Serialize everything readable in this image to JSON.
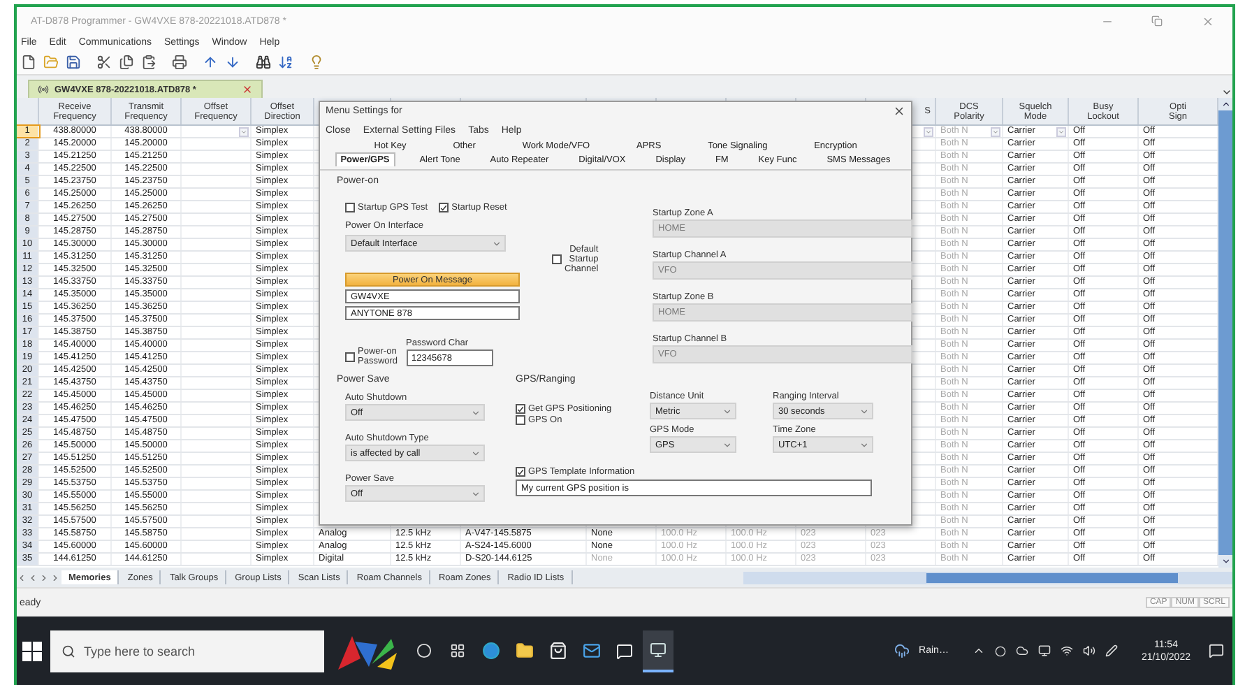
{
  "window": {
    "title": "AT-D878 Programmer - GW4VXE 878-20221018.ATD878 *"
  },
  "menu_bar": [
    "File",
    "Edit",
    "Communications",
    "Settings",
    "Window",
    "Help"
  ],
  "document_tab": {
    "label": "GW4VXE 878-20221018.ATD878 *"
  },
  "grid": {
    "headers": {
      "receive_frequency": "Receive\nFrequency",
      "transmit_frequency": "Transmit\nFrequency",
      "offset_frequency": "Offset\nFrequency",
      "offset_direction": "Offset\nDirection",
      "column_13": "S",
      "dcs_polarity": "DCS\nPolarity",
      "squelch_mode": "Squelch\nMode",
      "busy_lockout": "Busy\nLockout",
      "column_17": "Opti\nSign"
    },
    "rows": [
      {
        "no": "1",
        "selected": true,
        "receive_frequency": "438.80000",
        "transmit_frequency": "438.80000",
        "offset_direction": "Simplex",
        "dcs_polarity": "Both N",
        "squelch_mode": "Carrier",
        "busy_lockout": "Off",
        "column_17": "Off"
      },
      {
        "no": "2",
        "selected": false,
        "receive_frequency": "145.20000",
        "transmit_frequency": "145.20000",
        "offset_direction": "Simplex",
        "dcs_polarity": "Both N",
        "squelch_mode": "Carrier",
        "busy_lockout": "Off",
        "column_17": "Off"
      },
      {
        "no": "3",
        "selected": false,
        "receive_frequency": "145.21250",
        "transmit_frequency": "145.21250",
        "offset_direction": "Simplex",
        "dcs_polarity": "Both N",
        "squelch_mode": "Carrier",
        "busy_lockout": "Off",
        "column_17": "Off"
      },
      {
        "no": "4",
        "selected": false,
        "receive_frequency": "145.22500",
        "transmit_frequency": "145.22500",
        "offset_direction": "Simplex",
        "dcs_polarity": "Both N",
        "squelch_mode": "Carrier",
        "busy_lockout": "Off",
        "column_17": "Off"
      },
      {
        "no": "5",
        "selected": false,
        "receive_frequency": "145.23750",
        "transmit_frequency": "145.23750",
        "offset_direction": "Simplex",
        "dcs_polarity": "Both N",
        "squelch_mode": "Carrier",
        "busy_lockout": "Off",
        "column_17": "Off"
      },
      {
        "no": "6",
        "selected": false,
        "receive_frequency": "145.25000",
        "transmit_frequency": "145.25000",
        "offset_direction": "Simplex",
        "dcs_polarity": "Both N",
        "squelch_mode": "Carrier",
        "busy_lockout": "Off",
        "column_17": "Off"
      },
      {
        "no": "7",
        "selected": false,
        "receive_frequency": "145.26250",
        "transmit_frequency": "145.26250",
        "offset_direction": "Simplex",
        "dcs_polarity": "Both N",
        "squelch_mode": "Carrier",
        "busy_lockout": "Off",
        "column_17": "Off"
      },
      {
        "no": "8",
        "selected": false,
        "receive_frequency": "145.27500",
        "transmit_frequency": "145.27500",
        "offset_direction": "Simplex",
        "dcs_polarity": "Both N",
        "squelch_mode": "Carrier",
        "busy_lockout": "Off",
        "column_17": "Off"
      },
      {
        "no": "9",
        "selected": false,
        "receive_frequency": "145.28750",
        "transmit_frequency": "145.28750",
        "offset_direction": "Simplex",
        "dcs_polarity": "Both N",
        "squelch_mode": "Carrier",
        "busy_lockout": "Off",
        "column_17": "Off"
      },
      {
        "no": "10",
        "selected": false,
        "receive_frequency": "145.30000",
        "transmit_frequency": "145.30000",
        "offset_direction": "Simplex",
        "dcs_polarity": "Both N",
        "squelch_mode": "Carrier",
        "busy_lockout": "Off",
        "column_17": "Off"
      },
      {
        "no": "11",
        "selected": false,
        "receive_frequency": "145.31250",
        "transmit_frequency": "145.31250",
        "offset_direction": "Simplex",
        "dcs_polarity": "Both N",
        "squelch_mode": "Carrier",
        "busy_lockout": "Off",
        "column_17": "Off"
      },
      {
        "no": "12",
        "selected": false,
        "receive_frequency": "145.32500",
        "transmit_frequency": "145.32500",
        "offset_direction": "Simplex",
        "dcs_polarity": "Both N",
        "squelch_mode": "Carrier",
        "busy_lockout": "Off",
        "column_17": "Off"
      },
      {
        "no": "13",
        "selected": false,
        "receive_frequency": "145.33750",
        "transmit_frequency": "145.33750",
        "offset_direction": "Simplex",
        "dcs_polarity": "Both N",
        "squelch_mode": "Carrier",
        "busy_lockout": "Off",
        "column_17": "Off"
      },
      {
        "no": "14",
        "selected": false,
        "receive_frequency": "145.35000",
        "transmit_frequency": "145.35000",
        "offset_direction": "Simplex",
        "dcs_polarity": "Both N",
        "squelch_mode": "Carrier",
        "busy_lockout": "Off",
        "column_17": "Off"
      },
      {
        "no": "15",
        "selected": false,
        "receive_frequency": "145.36250",
        "transmit_frequency": "145.36250",
        "offset_direction": "Simplex",
        "dcs_polarity": "Both N",
        "squelch_mode": "Carrier",
        "busy_lockout": "Off",
        "column_17": "Off"
      },
      {
        "no": "16",
        "selected": false,
        "receive_frequency": "145.37500",
        "transmit_frequency": "145.37500",
        "offset_direction": "Simplex",
        "dcs_polarity": "Both N",
        "squelch_mode": "Carrier",
        "busy_lockout": "Off",
        "column_17": "Off"
      },
      {
        "no": "17",
        "selected": false,
        "receive_frequency": "145.38750",
        "transmit_frequency": "145.38750",
        "offset_direction": "Simplex",
        "dcs_polarity": "Both N",
        "squelch_mode": "Carrier",
        "busy_lockout": "Off",
        "column_17": "Off"
      },
      {
        "no": "18",
        "selected": false,
        "receive_frequency": "145.40000",
        "transmit_frequency": "145.40000",
        "offset_direction": "Simplex",
        "dcs_polarity": "Both N",
        "squelch_mode": "Carrier",
        "busy_lockout": "Off",
        "column_17": "Off"
      },
      {
        "no": "19",
        "selected": false,
        "receive_frequency": "145.41250",
        "transmit_frequency": "145.41250",
        "offset_direction": "Simplex",
        "dcs_polarity": "Both N",
        "squelch_mode": "Carrier",
        "busy_lockout": "Off",
        "column_17": "Off"
      },
      {
        "no": "20",
        "selected": false,
        "receive_frequency": "145.42500",
        "transmit_frequency": "145.42500",
        "offset_direction": "Simplex",
        "dcs_polarity": "Both N",
        "squelch_mode": "Carrier",
        "busy_lockout": "Off",
        "column_17": "Off"
      },
      {
        "no": "21",
        "selected": false,
        "receive_frequency": "145.43750",
        "transmit_frequency": "145.43750",
        "offset_direction": "Simplex",
        "dcs_polarity": "Both N",
        "squelch_mode": "Carrier",
        "busy_lockout": "Off",
        "column_17": "Off"
      },
      {
        "no": "22",
        "selected": false,
        "receive_frequency": "145.45000",
        "transmit_frequency": "145.45000",
        "offset_direction": "Simplex",
        "dcs_polarity": "Both N",
        "squelch_mode": "Carrier",
        "busy_lockout": "Off",
        "column_17": "Off"
      },
      {
        "no": "23",
        "selected": false,
        "receive_frequency": "145.46250",
        "transmit_frequency": "145.46250",
        "offset_direction": "Simplex",
        "dcs_polarity": "Both N",
        "squelch_mode": "Carrier",
        "busy_lockout": "Off",
        "column_17": "Off"
      },
      {
        "no": "24",
        "selected": false,
        "receive_frequency": "145.47500",
        "transmit_frequency": "145.47500",
        "offset_direction": "Simplex",
        "dcs_polarity": "Both N",
        "squelch_mode": "Carrier",
        "busy_lockout": "Off",
        "column_17": "Off"
      },
      {
        "no": "25",
        "selected": false,
        "receive_frequency": "145.48750",
        "transmit_frequency": "145.48750",
        "offset_direction": "Simplex",
        "dcs_polarity": "Both N",
        "squelch_mode": "Carrier",
        "busy_lockout": "Off",
        "column_17": "Off"
      },
      {
        "no": "26",
        "selected": false,
        "receive_frequency": "145.50000",
        "transmit_frequency": "145.50000",
        "offset_direction": "Simplex",
        "dcs_polarity": "Both N",
        "squelch_mode": "Carrier",
        "busy_lockout": "Off",
        "column_17": "Off"
      },
      {
        "no": "27",
        "selected": false,
        "receive_frequency": "145.51250",
        "transmit_frequency": "145.51250",
        "offset_direction": "Simplex",
        "dcs_polarity": "Both N",
        "squelch_mode": "Carrier",
        "busy_lockout": "Off",
        "column_17": "Off"
      },
      {
        "no": "28",
        "selected": false,
        "receive_frequency": "145.52500",
        "transmit_frequency": "145.52500",
        "offset_direction": "Simplex",
        "dcs_polarity": "Both N",
        "squelch_mode": "Carrier",
        "busy_lockout": "Off",
        "column_17": "Off"
      },
      {
        "no": "29",
        "selected": false,
        "receive_frequency": "145.53750",
        "transmit_frequency": "145.53750",
        "offset_direction": "Simplex",
        "dcs_polarity": "Both N",
        "squelch_mode": "Carrier",
        "busy_lockout": "Off",
        "column_17": "Off"
      },
      {
        "no": "30",
        "selected": false,
        "receive_frequency": "145.55000",
        "transmit_frequency": "145.55000",
        "offset_direction": "Simplex",
        "dcs_polarity": "Both N",
        "squelch_mode": "Carrier",
        "busy_lockout": "Off",
        "column_17": "Off"
      },
      {
        "no": "31",
        "selected": false,
        "receive_frequency": "145.56250",
        "transmit_frequency": "145.56250",
        "offset_direction": "Simplex",
        "dcs_polarity": "Both N",
        "squelch_mode": "Carrier",
        "busy_lockout": "Off",
        "column_17": "Off"
      },
      {
        "no": "32",
        "selected": false,
        "receive_frequency": "145.57500",
        "transmit_frequency": "145.57500",
        "offset_direction": "Simplex",
        "dcs_polarity": "Both N",
        "squelch_mode": "Carrier",
        "busy_lockout": "Off",
        "column_17": "Off"
      },
      {
        "no": "33",
        "selected": false,
        "receive_frequency": "145.58750",
        "transmit_frequency": "145.58750",
        "offset_direction": "Simplex",
        "column_6": "Analog",
        "column_7": "12.5 kHz",
        "column_8": "A-V47-145.5875",
        "column_9": {
          "text": "None",
          "disabled": false
        },
        "column_10": "100.0 Hz",
        "column_11": "100.0 Hz",
        "column_12": "023",
        "column_13": "023",
        "dcs_polarity": "Both N",
        "squelch_mode": "Carrier",
        "busy_lockout": "Off",
        "column_17": "Off"
      },
      {
        "no": "34",
        "selected": false,
        "receive_frequency": "145.60000",
        "transmit_frequency": "145.60000",
        "offset_direction": "Simplex",
        "column_6": "Analog",
        "column_7": "12.5 kHz",
        "column_8": "A-S24-145.6000",
        "column_9": {
          "text": "None",
          "disabled": false
        },
        "column_10": "100.0 Hz",
        "column_11": "100.0 Hz",
        "column_12": "023",
        "column_13": "023",
        "dcs_polarity": "Both N",
        "squelch_mode": "Carrier",
        "busy_lockout": "Off",
        "column_17": "Off"
      },
      {
        "no": "35",
        "selected": false,
        "receive_frequency": "144.61250",
        "transmit_frequency": "144.61250",
        "offset_direction": "Simplex",
        "column_6": "Digital",
        "column_7": "12.5 kHz",
        "column_8": "D-S20-144.6125",
        "column_9": {
          "text": "None",
          "disabled": true
        },
        "column_10": "100.0 Hz",
        "column_11": "100.0 Hz",
        "column_12": "023",
        "column_13": "023",
        "dcs_polarity": "Both N",
        "squelch_mode": "Carrier",
        "busy_lockout": "Off",
        "column_17": "Off"
      }
    ]
  },
  "sheet_tabs": [
    {
      "label": "Memories",
      "selected": true
    },
    {
      "label": "Zones",
      "selected": false
    },
    {
      "label": "Talk Groups",
      "selected": false
    },
    {
      "label": "Group Lists",
      "selected": false
    },
    {
      "label": "Scan Lists",
      "selected": false
    },
    {
      "label": "Roam Channels",
      "selected": false
    },
    {
      "label": "Roam Zones",
      "selected": false
    },
    {
      "label": "Radio ID Lists",
      "selected": false
    }
  ],
  "status_bar": {
    "text": "eady",
    "indicators": [
      "CAP",
      "NUM",
      "SCRL"
    ]
  },
  "settings_dialog": {
    "title": "Menu Settings for",
    "menu": [
      "Close",
      "External Setting Files",
      "Tabs",
      "Help"
    ],
    "tab_rows": [
      [
        {
          "label": "Hot Key",
          "selected": false
        },
        {
          "label": "Other",
          "selected": false
        },
        {
          "label": "Work Mode/VFO",
          "selected": false
        },
        {
          "label": "APRS",
          "selected": false
        },
        {
          "label": "Tone Signaling",
          "selected": false
        },
        {
          "label": "Encryption",
          "selected": false
        }
      ],
      [
        {
          "label": "Power/GPS",
          "selected": true
        },
        {
          "label": "Alert Tone",
          "selected": false
        },
        {
          "label": "Auto Repeater",
          "selected": false
        },
        {
          "label": "Digital/VOX",
          "selected": false
        },
        {
          "label": "Display",
          "selected": false
        },
        {
          "label": "FM",
          "selected": false
        },
        {
          "label": "Key Func",
          "selected": false
        },
        {
          "label": "SMS Messages",
          "selected": false
        }
      ]
    ],
    "power_on": {
      "heading": "Power-on",
      "checkboxes": [
        {
          "label": "Startup GPS Test",
          "checked": false
        },
        {
          "label": "Startup Reset",
          "checked": true
        }
      ],
      "interface": {
        "label": "Power On Interface",
        "value": "Default Interface"
      },
      "default_startup_channel": {
        "label": "Default\nStartup\nChannel",
        "checked": false
      },
      "startup_fields": [
        {
          "label": "Startup Zone A",
          "value": "HOME",
          "disabled": true
        },
        {
          "label": "Startup Channel A",
          "value": "VFO",
          "disabled": true
        },
        {
          "label": "Startup Zone B",
          "value": "HOME",
          "disabled": true
        },
        {
          "label": "Startup Channel B",
          "value": "VFO",
          "disabled": true
        }
      ],
      "message": {
        "button": "Power On Message",
        "lines": [
          "GW4VXE",
          "ANYTONE 878"
        ]
      },
      "password": {
        "label": "Power-on\nPassword",
        "checked": false
      },
      "password_char": {
        "label": "Password Char",
        "value": "12345678"
      }
    },
    "power_save": {
      "heading": "Power Save",
      "selects": [
        {
          "label": "Auto Shutdown",
          "value": "Off"
        },
        {
          "label": "Auto Shutdown Type",
          "value": "is affected by call"
        },
        {
          "label": "Power Save",
          "value": "Off"
        }
      ]
    },
    "gps_ranging": {
      "heading": "GPS/Ranging",
      "checkboxes": [
        {
          "label": "Get GPS Positioning",
          "checked": true
        },
        {
          "label": "GPS On",
          "checked": false
        }
      ],
      "selects": [
        {
          "label": "Distance Unit",
          "value": "Metric"
        },
        {
          "label": "Ranging Interval",
          "value": "30 seconds"
        },
        {
          "label": "GPS Mode",
          "value": "GPS"
        },
        {
          "label": "Time Zone",
          "value": "UTC+1"
        }
      ],
      "template": {
        "label": "GPS Template Information",
        "checked": true,
        "value": "My current GPS position is"
      }
    }
  },
  "taskbar": {
    "search": {
      "placeholder": "Type here to search"
    },
    "weather": "Rain…",
    "time": "11:54",
    "date": "21/10/2022"
  }
}
